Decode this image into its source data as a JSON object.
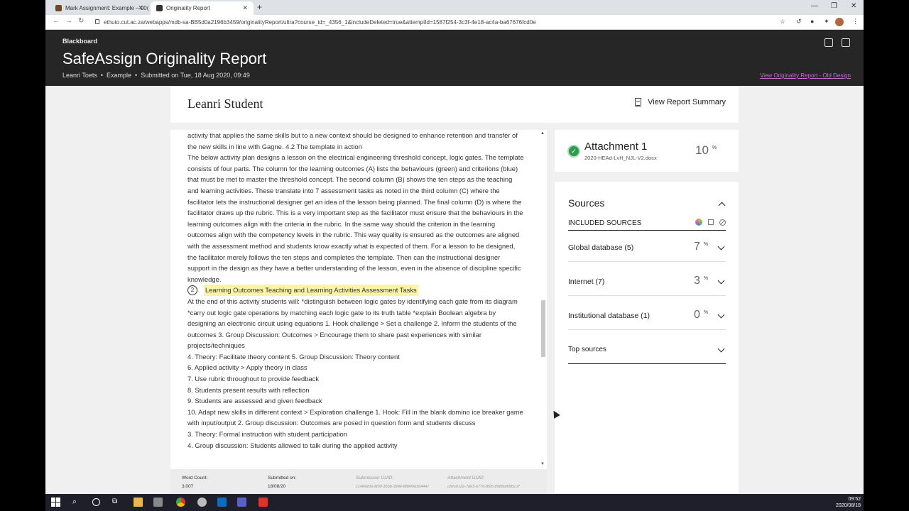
{
  "browser": {
    "tabs": [
      {
        "label": "Mark Assignment: Example – 00(",
        "active": false
      },
      {
        "label": "Originality Report",
        "active": true
      }
    ],
    "url": "ethuto.cut.ac.za/webapps/mdb-sa-BB5d0a2196b3459/originalityReport/ultra?course_id=_4356_1&includeDeleted=true&attemptId=1587f254-3c3f-4e18-ac4a-ba67676fcd0e"
  },
  "header": {
    "brand": "Blackboard",
    "title": "SafeAssign Originality Report",
    "meta": {
      "author": "Leanri Toets",
      "course": "Example",
      "submitted": "Submitted on Tue, 18 Aug 2020, 09:49"
    },
    "old_link": "View Originality Report - Old Design"
  },
  "report": {
    "student": "Leanri Student",
    "summary_label": "View Report Summary"
  },
  "document": {
    "paragraph_before": "activity that applies the same skills but to a new context should be designed to enhance retention and transfer of the new skills in line with Gagne. 4.2 The template in action\nThe below activity plan designs a lesson on the electrical engineering threshold concept, logic gates. The template consists of four parts. The column for the learning outcomes (A) lists the behaviours (green) and criterions (blue) that must be met to master the threshold concept. The second column (B) shows the ten steps as the teaching and learning activities. These translate into 7 assessment tasks as noted in the third column (C) where the facilitator lets the instructional designer get an idea of the lesson being planned. The final column (D) is where the facilitator draws up the rubric. This is a very important step as the facilitator must ensure that the behaviours in the learning outcomes align with the criteria in the rubric. In the same way should the criterion in the learning outcomes align with the competency levels in the rubric. This way quality is ensured as the outcomes are aligned with the assessment method and students know exactly what is expected of them. For a lesson to be designed, the facilitator merely follows the ten steps and completes the template. Then can the instructional designer support in the design as they have a better understanding of the lesson, even in the absence of discipline specific knowledge.",
    "match_number": "2",
    "match_text": "Learning Outcomes Teaching and Learning Activities Assessment Tasks",
    "paragraph_after": "At the end of this activity students will: *distinguish between logic gates by identifying each gate from its diagram *carry out logic gate operations by matching each logic gate to its truth table *explain Boolean algebra by designing an electronic circuit using equations 1. Hook challenge > Set a challenge 2. Inform the students of the outcomes 3. Group Discussion: Outcomes > Encourage them to share past experiences with similar projects/techniques\n4. Theory: Facilitate theory content 5. Group Discussion: Theory content\n6. Applied activity > Apply theory in class\n7. Use rubric throughout to provide feedback\n8. Students present results with reflection\n9. Students are assessed and given feedback\n10. Adapt new skills in different context > Exploration challenge 1. Hook: Fill in the blank domino ice breaker game with input/output 2. Group discussion: Outcomes are posed in question form and students discuss\n3. Theory: Formal instruction with student participation\n4. Group discussion: Students allowed to talk during the applied activity"
  },
  "footer": {
    "word_count_label": "Word Count:",
    "word_count": "3,007",
    "submitted_label": "Submitted on:",
    "submitted": "18/08/20",
    "submission_uuid_label": "Submission UUID:",
    "submission_uuid": "c1484206-8f30-350b-3984-88845b364447",
    "attachment_uuid_label": "Attachment UUID:",
    "attachment_uuid": "c82e012e-7d63-6776-8f05-8988a8085c7f"
  },
  "attachment": {
    "title": "Attachment 1",
    "filename": "2020-HEAd-LvH_NJL-V2.docx",
    "percent": "10",
    "percent_sign": "%"
  },
  "sources": {
    "title": "Sources",
    "included_label": "INCLUDED SOURCES",
    "rows": [
      {
        "label": "Global database (5)",
        "percent": "7",
        "sign": "%"
      },
      {
        "label": "Internet (7)",
        "percent": "3",
        "sign": "%"
      },
      {
        "label": "Institutional database (1)",
        "percent": "0",
        "sign": "%"
      },
      {
        "label": "Top sources",
        "percent": "",
        "sign": ""
      }
    ]
  },
  "taskbar": {
    "time": "09:52",
    "date": "2020/08/18"
  },
  "colors": {
    "header_bg": "#262626",
    "highlight": "#fbf3a6",
    "check_green": "#2f9b4e",
    "old_link": "#c46cc9"
  }
}
